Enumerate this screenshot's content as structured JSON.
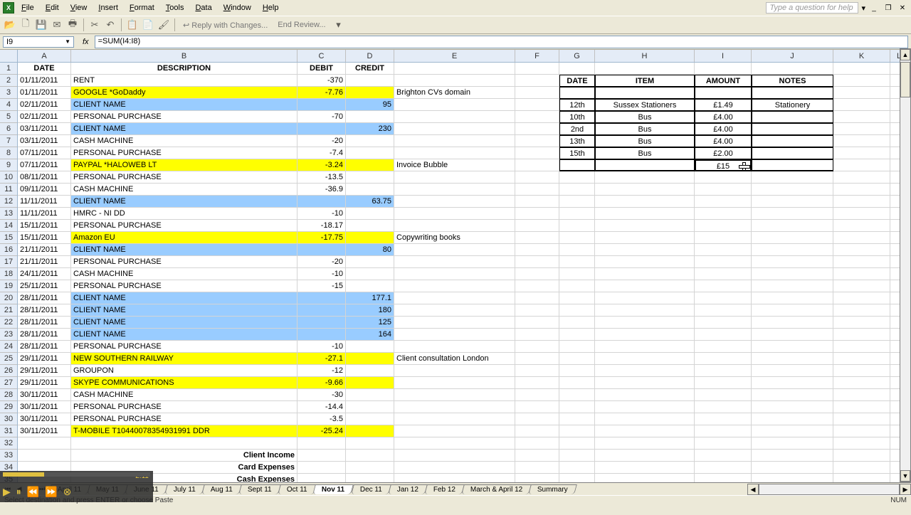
{
  "menu": {
    "items": [
      "File",
      "Edit",
      "View",
      "Insert",
      "Format",
      "Tools",
      "Data",
      "Window",
      "Help"
    ],
    "help_placeholder": "Type a question for help"
  },
  "toolbar": {
    "reply": "Reply with Changes...",
    "end_review": "End Review..."
  },
  "namebox": "I9",
  "formula": "=SUM(I4:I8)",
  "columns": [
    "A",
    "B",
    "C",
    "D",
    "E",
    "F",
    "G",
    "H",
    "I",
    "J",
    "K",
    "L"
  ],
  "headers": {
    "date": "DATE",
    "desc": "DESCRIPTION",
    "debit": "DEBIT",
    "credit": "CREDIT"
  },
  "side": {
    "headers": {
      "date": "DATE",
      "item": "ITEM",
      "amount": "AMOUNT",
      "notes": "NOTES"
    },
    "rows": [
      {
        "date": "12th",
        "item": "Sussex Stationers",
        "amount": "£1.49",
        "notes": "Stationery"
      },
      {
        "date": "10th",
        "item": "Bus",
        "amount": "£4.00",
        "notes": ""
      },
      {
        "date": "2nd",
        "item": "Bus",
        "amount": "£4.00",
        "notes": ""
      },
      {
        "date": "13th",
        "item": "Bus",
        "amount": "£4.00",
        "notes": ""
      },
      {
        "date": "15th",
        "item": "Bus",
        "amount": "£2.00",
        "notes": ""
      }
    ],
    "sum": "£15"
  },
  "rows": [
    {
      "r": 2,
      "date": "01/11/2011",
      "desc": "RENT",
      "debit": "-370",
      "credit": "",
      "e": "",
      "hl": ""
    },
    {
      "r": 3,
      "date": "01/11/2011",
      "desc": "GOOGLE *GoDaddy",
      "debit": "-7.76",
      "credit": "",
      "e": "Brighton CVs domain",
      "hl": "y"
    },
    {
      "r": 4,
      "date": "02/11/2011",
      "desc": "CLIENT NAME",
      "debit": "",
      "credit": "95",
      "e": "",
      "hl": "b"
    },
    {
      "r": 5,
      "date": "02/11/2011",
      "desc": "PERSONAL PURCHASE",
      "debit": "-70",
      "credit": "",
      "e": "",
      "hl": ""
    },
    {
      "r": 6,
      "date": "03/11/2011",
      "desc": "CLIENT NAME",
      "debit": "",
      "credit": "230",
      "e": "",
      "hl": "b"
    },
    {
      "r": 7,
      "date": "03/11/2011",
      "desc": "CASH MACHINE",
      "debit": "-20",
      "credit": "",
      "e": "",
      "hl": ""
    },
    {
      "r": 8,
      "date": "07/11/2011",
      "desc": "PERSONAL PURCHASE",
      "debit": "-7.4",
      "credit": "",
      "e": "",
      "hl": ""
    },
    {
      "r": 9,
      "date": "07/11/2011",
      "desc": "PAYPAL *HALOWEB LT",
      "debit": "-3.24",
      "credit": "",
      "e": "Invoice Bubble",
      "hl": "y"
    },
    {
      "r": 10,
      "date": "08/11/2011",
      "desc": "PERSONAL PURCHASE",
      "debit": "-13.5",
      "credit": "",
      "e": "",
      "hl": ""
    },
    {
      "r": 11,
      "date": "09/11/2011",
      "desc": "CASH MACHINE",
      "debit": "-36.9",
      "credit": "",
      "e": "",
      "hl": ""
    },
    {
      "r": 12,
      "date": "11/11/2011",
      "desc": "CLIENT NAME",
      "debit": "",
      "credit": "63.75",
      "e": "",
      "hl": "b"
    },
    {
      "r": 13,
      "date": "11/11/2011",
      "desc": "HMRC - NI DD",
      "debit": "-10",
      "credit": "",
      "e": "",
      "hl": ""
    },
    {
      "r": 14,
      "date": "15/11/2011",
      "desc": "PERSONAL PURCHASE",
      "debit": "-18.17",
      "credit": "",
      "e": "",
      "hl": ""
    },
    {
      "r": 15,
      "date": "15/11/2011",
      "desc": "Amazon EU",
      "debit": "-17.75",
      "credit": "",
      "e": "Copywriting books",
      "hl": "y"
    },
    {
      "r": 16,
      "date": "21/11/2011",
      "desc": "CLIENT NAME",
      "debit": "",
      "credit": "80",
      "e": "",
      "hl": "b"
    },
    {
      "r": 17,
      "date": "21/11/2011",
      "desc": "PERSONAL PURCHASE",
      "debit": "-20",
      "credit": "",
      "e": "",
      "hl": ""
    },
    {
      "r": 18,
      "date": "24/11/2011",
      "desc": "CASH MACHINE",
      "debit": "-10",
      "credit": "",
      "e": "",
      "hl": ""
    },
    {
      "r": 19,
      "date": "25/11/2011",
      "desc": "PERSONAL PURCHASE",
      "debit": "-15",
      "credit": "",
      "e": "",
      "hl": ""
    },
    {
      "r": 20,
      "date": "28/11/2011",
      "desc": "CLIENT NAME",
      "debit": "",
      "credit": "177.1",
      "e": "",
      "hl": "b"
    },
    {
      "r": 21,
      "date": "28/11/2011",
      "desc": "CLIENT NAME",
      "debit": "",
      "credit": "180",
      "e": "",
      "hl": "b"
    },
    {
      "r": 22,
      "date": "28/11/2011",
      "desc": "CLIENT NAME",
      "debit": "",
      "credit": "125",
      "e": "",
      "hl": "b"
    },
    {
      "r": 23,
      "date": "28/11/2011",
      "desc": "CLIENT NAME",
      "debit": "",
      "credit": "164",
      "e": "",
      "hl": "b"
    },
    {
      "r": 24,
      "date": "28/11/2011",
      "desc": "PERSONAL PURCHASE",
      "debit": "-10",
      "credit": "",
      "e": "",
      "hl": ""
    },
    {
      "r": 25,
      "date": "29/11/2011",
      "desc": "NEW SOUTHERN RAILWAY",
      "debit": "-27.1",
      "credit": "",
      "e": "Client consultation London",
      "hl": "y"
    },
    {
      "r": 26,
      "date": "29/11/2011",
      "desc": "GROUPON",
      "debit": "-12",
      "credit": "",
      "e": "",
      "hl": ""
    },
    {
      "r": 27,
      "date": "29/11/2011",
      "desc": "SKYPE COMMUNICATIONS",
      "debit": "-9.66",
      "credit": "",
      "e": "",
      "hl": "y"
    },
    {
      "r": 28,
      "date": "30/11/2011",
      "desc": "CASH MACHINE",
      "debit": "-30",
      "credit": "",
      "e": "",
      "hl": ""
    },
    {
      "r": 29,
      "date": "30/11/2011",
      "desc": "PERSONAL PURCHASE",
      "debit": "-14.4",
      "credit": "",
      "e": "",
      "hl": ""
    },
    {
      "r": 30,
      "date": "30/11/2011",
      "desc": "PERSONAL PURCHASE",
      "debit": "-3.5",
      "credit": "",
      "e": "",
      "hl": ""
    },
    {
      "r": 31,
      "date": "30/11/2011",
      "desc": "T-MOBILE          T10440078354931991 DDR",
      "debit": "-25.24",
      "credit": "",
      "e": "",
      "hl": "y"
    }
  ],
  "summary": {
    "client_income": "Client Income",
    "card_expenses": "Card Expenses",
    "cash_expenses": "Cash Expenses"
  },
  "tabs": [
    "April 11",
    "May 11",
    "June 11",
    "July 11",
    "Aug 11",
    "Sept 11",
    "Oct 11",
    "Nov 11",
    "Dec 11",
    "Jan 12",
    "Feb 12",
    "March & April 12",
    "Summary"
  ],
  "active_tab": "Nov 11",
  "status": {
    "left": "Select destination and press ENTER or choose Paste",
    "right": "NUM"
  },
  "media": {
    "time": "2:11"
  }
}
